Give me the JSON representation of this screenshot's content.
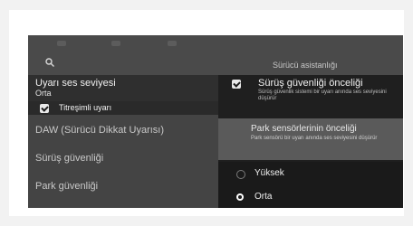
{
  "top_bar": {
    "title": "Sürücü asistanlığı",
    "icons": [
      "status-indicator",
      "status-indicator",
      "status-indicator"
    ]
  },
  "left_panel": {
    "volume_label": "Uyarı ses seviyesi",
    "volume_value": "Orta",
    "vibration_label": "Titreşimli uyarı",
    "vibration_checked": true,
    "items": [
      {
        "label": "DAW (Sürücü Dikkat Uyarısı)"
      },
      {
        "label": "Sürüş güvenliği"
      },
      {
        "label": "Park güvenliği"
      }
    ]
  },
  "right_panel": {
    "driving_safety_label": "Sürüş güvenliği önceliği",
    "driving_safety_desc": "Sürüş güvenlik sistemi bir uyarı anında ses seviyesini düşürür",
    "driving_safety_checked": true,
    "park_safety_label": "Park sensörlerinin önceliği",
    "park_safety_desc": "Park sensörü bir uyarı anında ses seviyesini düşürür",
    "options": [
      {
        "label": "Yüksek",
        "selected": false
      },
      {
        "label": "Orta",
        "selected": true
      }
    ]
  }
}
